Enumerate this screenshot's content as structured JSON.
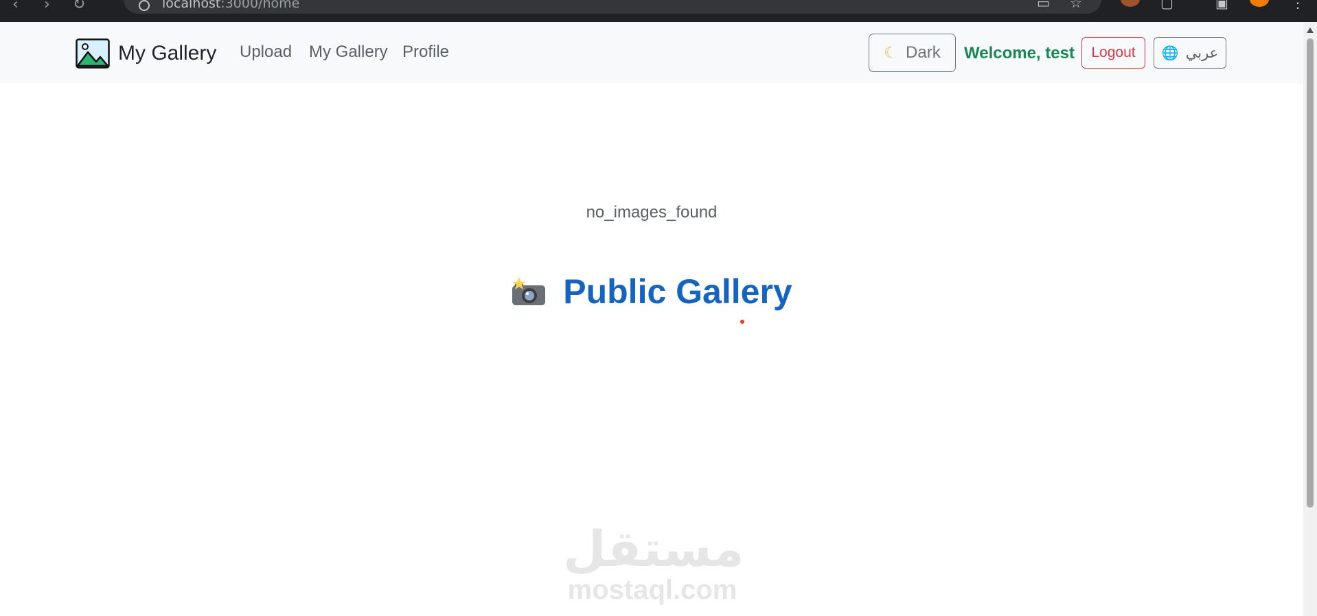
{
  "browser": {
    "url_host": "localhost",
    "url_rest": ":3000/home"
  },
  "navbar": {
    "brand": "My Gallery",
    "links": [
      "Upload",
      "My Gallery",
      "Profile"
    ],
    "theme_toggle_label": "Dark",
    "welcome_text": "Welcome, test",
    "logout_label": "Logout",
    "language_label": "عربي"
  },
  "main": {
    "empty_message": "no_images_found",
    "section_title": "Public Gallery"
  },
  "watermark": {
    "arabic": "مستقل",
    "latin": "mostaql.com"
  },
  "colors": {
    "accent_blue": "#1565c0",
    "welcome_green": "#198754",
    "logout_red": "#dc3545",
    "navbar_bg": "#f8f9fa"
  },
  "icons": {
    "brand": "image-landscape-icon",
    "theme": "moon-icon",
    "language": "globe-icon",
    "section": "camera-flash-icon"
  }
}
